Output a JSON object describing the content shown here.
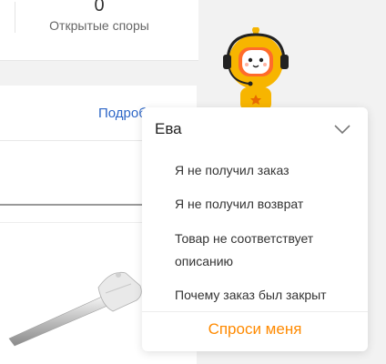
{
  "stats": {
    "open_disputes_count": "0",
    "open_disputes_label": "Открытые споры"
  },
  "panel": {
    "details_link": "Подробнее"
  },
  "assistant": {
    "name": "Ева",
    "questions": [
      {
        "label": "Я не получил заказ"
      },
      {
        "label": "Я не получил возврат"
      },
      {
        "label": "Товар не соответствует описанию"
      },
      {
        "label": "Почему заказ был закрыт"
      }
    ],
    "ask_label": "Спроси меня",
    "accent_color": "#ff8a00"
  },
  "colors": {
    "link": "#2d66c7",
    "background": "#f2f2f2"
  },
  "icons": [
    "chevron-down-icon",
    "assistant-mascot",
    "key-illustration"
  ]
}
